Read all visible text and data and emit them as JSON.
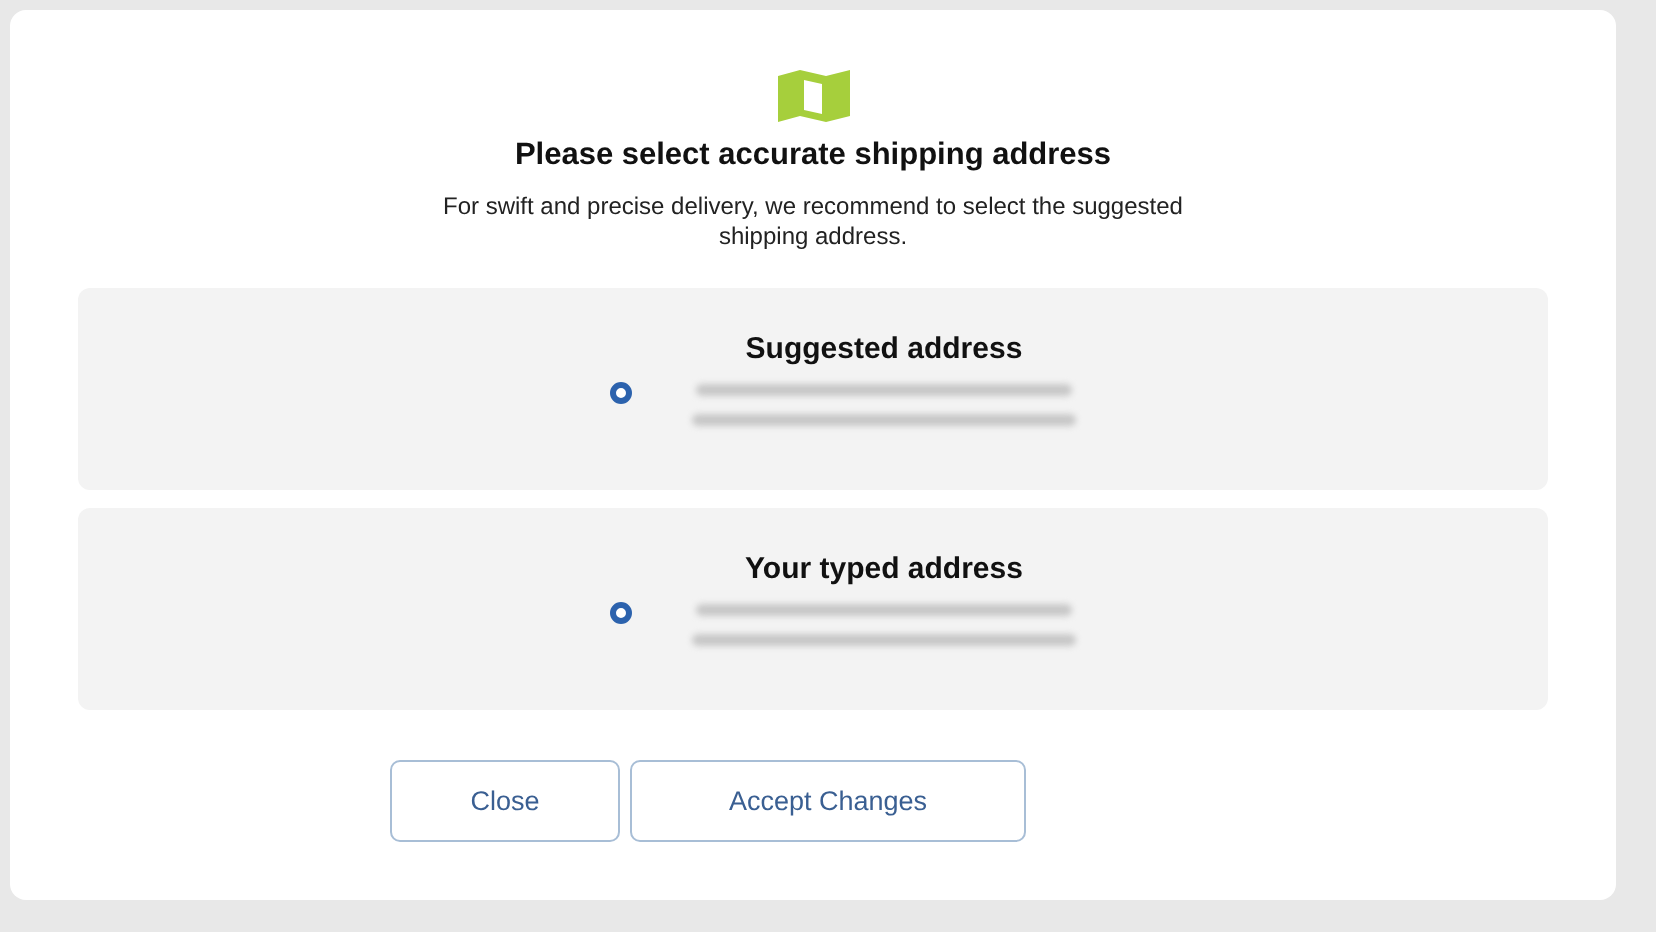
{
  "dialog": {
    "title": "Please select accurate shipping address",
    "subtitle": "For swift and precise delivery, we recommend to select the suggested shipping address."
  },
  "options": [
    {
      "label": "Suggested address",
      "selected": true
    },
    {
      "label": "Your typed address",
      "selected": true
    }
  ],
  "buttons": [
    {
      "label": "Close"
    },
    {
      "label": "Accept Changes"
    }
  ]
}
